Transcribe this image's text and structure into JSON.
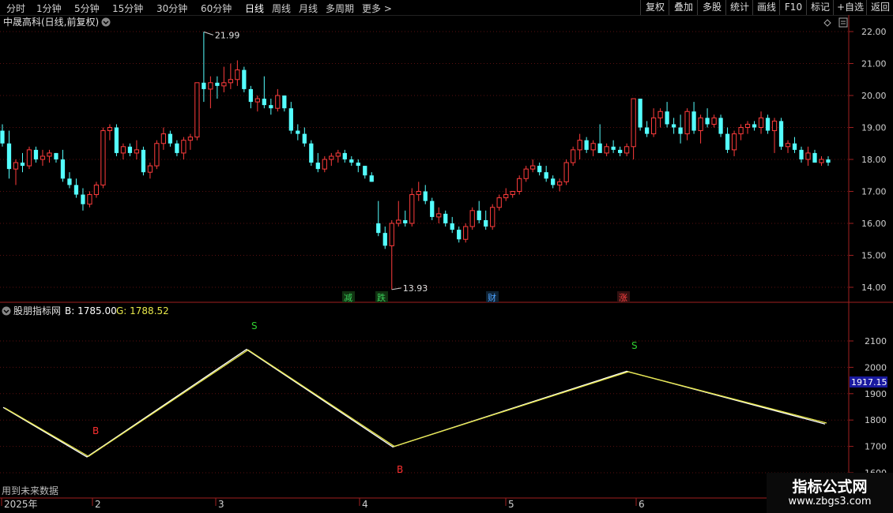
{
  "toolbar": {
    "periods": [
      "分时",
      "1分钟",
      "5分钟",
      "15分钟",
      "30分钟",
      "60分钟",
      "日线",
      "周线",
      "月线",
      "多周期",
      "更多 >"
    ],
    "active_period": "日线",
    "right_buttons": [
      "复权",
      "叠加",
      "多股",
      "统计",
      "画线",
      "F10",
      "标记",
      "+自选",
      "返回"
    ]
  },
  "price_panel": {
    "title": "中晟高科(日线,前复权)",
    "high_label": "21.99",
    "low_label": "13.93",
    "y_axis_ticks": [
      "22.00",
      "21.00",
      "20.00",
      "19.00",
      "18.00",
      "17.00",
      "16.00",
      "15.00",
      "14.00"
    ],
    "event_badges": [
      {
        "text": "减",
        "color": "#39d05a"
      },
      {
        "text": "跌",
        "color": "#39d05a"
      },
      {
        "text": "财",
        "color": "#4da3ff"
      },
      {
        "text": "涨",
        "color": "#ff4040"
      }
    ]
  },
  "indicator_panel": {
    "name": "股朋指标网",
    "b_label": "B: 1785.00",
    "g_label": "G: 1788.52",
    "y_axis_ticks": [
      "2100",
      "2000",
      "1900",
      "1800",
      "1700",
      "1600"
    ],
    "current_value": "1917.15",
    "signals": [
      {
        "text": "B",
        "color": "#ff3030"
      },
      {
        "text": "S",
        "color": "#30d030"
      },
      {
        "text": "B",
        "color": "#ff3030"
      },
      {
        "text": "S",
        "color": "#30d030"
      }
    ],
    "footer_note": "用到未来数据"
  },
  "date_axis": {
    "labels": [
      "2025年",
      "2",
      "3",
      "4",
      "5",
      "6"
    ]
  },
  "watermark": {
    "title": "指标公式网",
    "url": "www.zbgs3.com"
  },
  "chart_data": [
    {
      "type": "candlestick",
      "title": "中晟高科(日线,前复权)",
      "ylim": [
        13.6,
        22.3
      ],
      "up_color": "#ff3c3c",
      "down_color": "#54ffff",
      "candles": [
        [
          18.9,
          19.1,
          18.4,
          18.5
        ],
        [
          18.5,
          18.9,
          17.4,
          17.7
        ],
        [
          17.7,
          18.0,
          17.2,
          17.9
        ],
        [
          17.9,
          18.2,
          17.6,
          17.8
        ],
        [
          17.8,
          18.4,
          17.7,
          18.3
        ],
        [
          18.3,
          18.4,
          17.9,
          18.0
        ],
        [
          18.0,
          18.3,
          17.8,
          18.1
        ],
        [
          18.1,
          18.3,
          17.9,
          18.2
        ],
        [
          18.2,
          18.2,
          17.9,
          18.0
        ],
        [
          18.0,
          18.3,
          17.3,
          17.4
        ],
        [
          17.4,
          17.6,
          17.1,
          17.2
        ],
        [
          17.2,
          17.4,
          16.8,
          16.9
        ],
        [
          16.9,
          17.1,
          16.4,
          16.6
        ],
        [
          16.6,
          17.0,
          16.5,
          16.9
        ],
        [
          16.9,
          17.3,
          16.8,
          17.2
        ],
        [
          17.2,
          19.0,
          17.1,
          18.9
        ],
        [
          18.9,
          19.1,
          18.6,
          19.0
        ],
        [
          19.0,
          19.1,
          18.1,
          18.2
        ],
        [
          18.2,
          18.5,
          18.0,
          18.4
        ],
        [
          18.4,
          18.5,
          18.1,
          18.2
        ],
        [
          18.2,
          18.6,
          18.0,
          18.3
        ],
        [
          18.3,
          18.4,
          17.5,
          17.6
        ],
        [
          17.6,
          17.9,
          17.4,
          17.8
        ],
        [
          17.8,
          18.6,
          17.7,
          18.5
        ],
        [
          18.5,
          19.0,
          18.3,
          18.8
        ],
        [
          18.8,
          18.9,
          18.4,
          18.5
        ],
        [
          18.5,
          18.6,
          18.1,
          18.2
        ],
        [
          18.2,
          18.7,
          18.0,
          18.6
        ],
        [
          18.6,
          18.8,
          18.3,
          18.7
        ],
        [
          18.7,
          20.4,
          18.6,
          20.4
        ],
        [
          20.4,
          21.99,
          19.8,
          20.2
        ],
        [
          20.2,
          20.6,
          19.6,
          20.4
        ],
        [
          20.4,
          20.6,
          19.9,
          20.3
        ],
        [
          20.3,
          20.9,
          20.1,
          20.4
        ],
        [
          20.4,
          21.0,
          20.2,
          20.5
        ],
        [
          20.5,
          21.1,
          20.3,
          20.8
        ],
        [
          20.8,
          20.9,
          20.1,
          20.2
        ],
        [
          20.2,
          20.3,
          19.6,
          19.8
        ],
        [
          19.8,
          20.0,
          19.5,
          19.9
        ],
        [
          19.9,
          20.6,
          19.6,
          19.7
        ],
        [
          19.7,
          19.9,
          19.4,
          19.6
        ],
        [
          19.6,
          20.2,
          19.5,
          20.0
        ],
        [
          20.0,
          20.0,
          19.5,
          19.6
        ],
        [
          19.6,
          19.8,
          18.8,
          18.9
        ],
        [
          18.9,
          19.1,
          18.6,
          18.8
        ],
        [
          18.8,
          19.0,
          18.4,
          18.5
        ],
        [
          18.5,
          18.6,
          17.8,
          17.9
        ],
        [
          17.9,
          18.2,
          17.6,
          17.7
        ],
        [
          17.7,
          18.1,
          17.6,
          18.0
        ],
        [
          18.0,
          18.2,
          17.8,
          18.1
        ],
        [
          18.1,
          18.3,
          17.9,
          18.2
        ],
        [
          18.2,
          18.3,
          17.9,
          18.0
        ],
        [
          18.0,
          18.1,
          17.8,
          17.9
        ],
        [
          17.9,
          18.0,
          17.6,
          17.8
        ],
        [
          17.8,
          17.8,
          17.4,
          17.5
        ],
        [
          17.5,
          17.6,
          17.3,
          17.3
        ],
        [
          16.0,
          16.7,
          15.6,
          15.7
        ],
        [
          15.7,
          15.9,
          15.2,
          15.3
        ],
        [
          15.3,
          16.1,
          13.93,
          16.0
        ],
        [
          16.0,
          16.7,
          15.9,
          16.1
        ],
        [
          16.1,
          16.4,
          15.9,
          16.0
        ],
        [
          16.0,
          17.1,
          15.9,
          16.9
        ],
        [
          16.9,
          17.3,
          16.7,
          17.0
        ],
        [
          17.0,
          17.2,
          16.6,
          16.7
        ],
        [
          16.7,
          16.8,
          16.1,
          16.2
        ],
        [
          16.2,
          16.5,
          16.0,
          16.3
        ],
        [
          16.3,
          16.4,
          15.9,
          16.0
        ],
        [
          16.0,
          16.2,
          15.7,
          15.8
        ],
        [
          15.8,
          15.9,
          15.4,
          15.5
        ],
        [
          15.5,
          16.0,
          15.4,
          15.9
        ],
        [
          15.9,
          16.5,
          15.8,
          16.4
        ],
        [
          16.4,
          16.7,
          16.0,
          16.1
        ],
        [
          16.1,
          16.4,
          15.8,
          15.9
        ],
        [
          15.9,
          16.6,
          15.8,
          16.5
        ],
        [
          16.5,
          16.9,
          16.4,
          16.8
        ],
        [
          16.8,
          17.1,
          16.7,
          16.9
        ],
        [
          16.9,
          17.0,
          16.8,
          17.0
        ],
        [
          17.0,
          17.5,
          16.9,
          17.4
        ],
        [
          17.4,
          17.8,
          17.3,
          17.7
        ],
        [
          17.7,
          18.0,
          17.6,
          17.8
        ],
        [
          17.8,
          17.9,
          17.5,
          17.6
        ],
        [
          17.6,
          17.8,
          17.3,
          17.4
        ],
        [
          17.4,
          17.5,
          17.1,
          17.2
        ],
        [
          17.2,
          17.4,
          17.0,
          17.3
        ],
        [
          17.3,
          18.0,
          17.2,
          17.9
        ],
        [
          17.9,
          18.4,
          17.8,
          18.3
        ],
        [
          18.3,
          18.8,
          18.0,
          18.6
        ],
        [
          18.6,
          18.7,
          18.2,
          18.3
        ],
        [
          18.3,
          18.6,
          18.1,
          18.5
        ],
        [
          18.5,
          19.1,
          18.3,
          18.2
        ],
        [
          18.2,
          18.5,
          18.1,
          18.4
        ],
        [
          18.4,
          18.6,
          18.2,
          18.3
        ],
        [
          18.3,
          18.4,
          18.1,
          18.2
        ],
        [
          18.2,
          18.5,
          18.1,
          18.4
        ],
        [
          18.4,
          19.9,
          18.0,
          19.9
        ],
        [
          19.9,
          19.9,
          18.9,
          19.0
        ],
        [
          19.0,
          19.2,
          18.7,
          18.8
        ],
        [
          18.8,
          19.6,
          18.7,
          19.3
        ],
        [
          19.3,
          19.6,
          19.0,
          19.5
        ],
        [
          19.5,
          19.8,
          19.0,
          19.1
        ],
        [
          19.1,
          19.3,
          18.8,
          19.0
        ],
        [
          19.0,
          19.4,
          18.5,
          18.8
        ],
        [
          18.8,
          19.6,
          18.6,
          19.5
        ],
        [
          19.5,
          19.8,
          18.8,
          18.9
        ],
        [
          18.9,
          19.4,
          18.5,
          19.3
        ],
        [
          19.3,
          19.6,
          19.0,
          19.1
        ],
        [
          19.1,
          19.4,
          19.0,
          19.3
        ],
        [
          19.3,
          19.4,
          18.7,
          18.8
        ],
        [
          18.8,
          19.0,
          18.2,
          18.3
        ],
        [
          18.3,
          18.9,
          18.1,
          18.8
        ],
        [
          18.8,
          19.1,
          18.6,
          19.0
        ],
        [
          19.0,
          19.2,
          18.8,
          19.1
        ],
        [
          19.1,
          19.2,
          18.9,
          19.0
        ],
        [
          19.0,
          19.5,
          18.8,
          19.3
        ],
        [
          19.3,
          19.4,
          18.8,
          18.9
        ],
        [
          18.9,
          19.3,
          18.2,
          19.2
        ],
        [
          19.2,
          19.3,
          18.3,
          18.4
        ],
        [
          18.4,
          18.6,
          18.2,
          18.5
        ],
        [
          18.5,
          18.7,
          18.2,
          18.3
        ],
        [
          18.3,
          18.4,
          17.9,
          18.0
        ],
        [
          18.0,
          18.4,
          17.8,
          18.2
        ],
        [
          18.2,
          18.3,
          17.9,
          17.9
        ],
        [
          17.9,
          18.1,
          17.8,
          18.0
        ],
        [
          18.0,
          18.1,
          17.8,
          17.9
        ]
      ]
    },
    {
      "type": "line",
      "title": "股朋指标网",
      "ylim": [
        1600,
        2200
      ],
      "series": [
        {
          "name": "B",
          "color": "#ffffff",
          "values": [
            1848,
            1660,
            2068,
            1698,
            1985,
            1785
          ]
        },
        {
          "name": "G",
          "color": "#e8e84a",
          "values": [
            1846,
            1662,
            2066,
            1700,
            1983,
            1788.52
          ]
        }
      ]
    }
  ]
}
